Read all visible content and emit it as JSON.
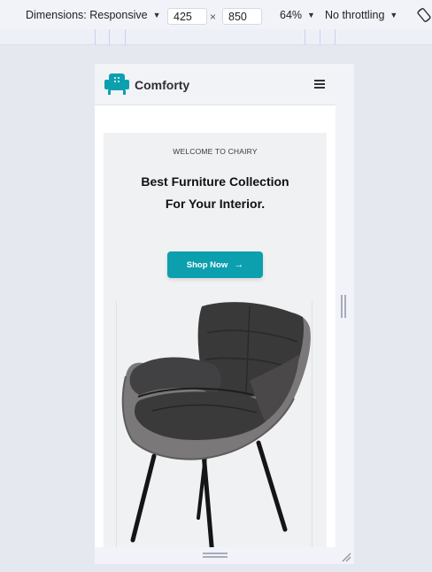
{
  "devtools": {
    "dimensions_label": "Dimensions: Responsive",
    "width_value": "425",
    "times_sign": "×",
    "height_value": "850",
    "zoom_label": "64%",
    "throttle_label": "No throttling",
    "caret": "▼"
  },
  "site": {
    "brand": "Comforty",
    "accent_color": "#0c9fae",
    "logo_icon": "armchair-icon",
    "menu_icon": "hamburger-icon"
  },
  "hero": {
    "eyebrow": "WELCOME TO CHAIRY",
    "headline": "Best Furniture Collection For Your Interior.",
    "cta_label": "Shop Now",
    "cta_icon": "→",
    "product_image": "gray-armchair-image"
  }
}
